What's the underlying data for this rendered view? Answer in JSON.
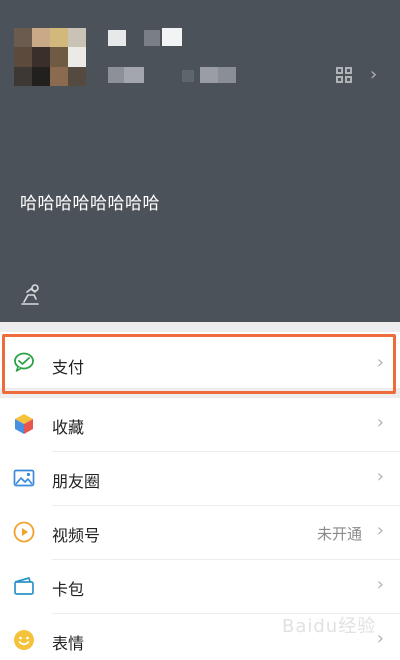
{
  "profile": {
    "status_text": "哈哈哈哈哈哈哈哈",
    "qr_icon": "qr-code-icon",
    "status_icon": "status-icon"
  },
  "menu": {
    "pay": {
      "label": "支付",
      "icon": "pay-icon"
    },
    "items": [
      {
        "label": "收藏",
        "icon": "favorites-icon"
      },
      {
        "label": "朋友圈",
        "icon": "moments-icon"
      },
      {
        "label": "视频号",
        "icon": "channels-icon",
        "value": "未开通"
      },
      {
        "label": "卡包",
        "icon": "cards-icon"
      },
      {
        "label": "表情",
        "icon": "stickers-icon"
      }
    ]
  },
  "watermark": "Baidu经验",
  "colors": {
    "header_bg": "#4c5259",
    "highlight": "#ee6b3b",
    "pay_green": "#2ba245"
  }
}
